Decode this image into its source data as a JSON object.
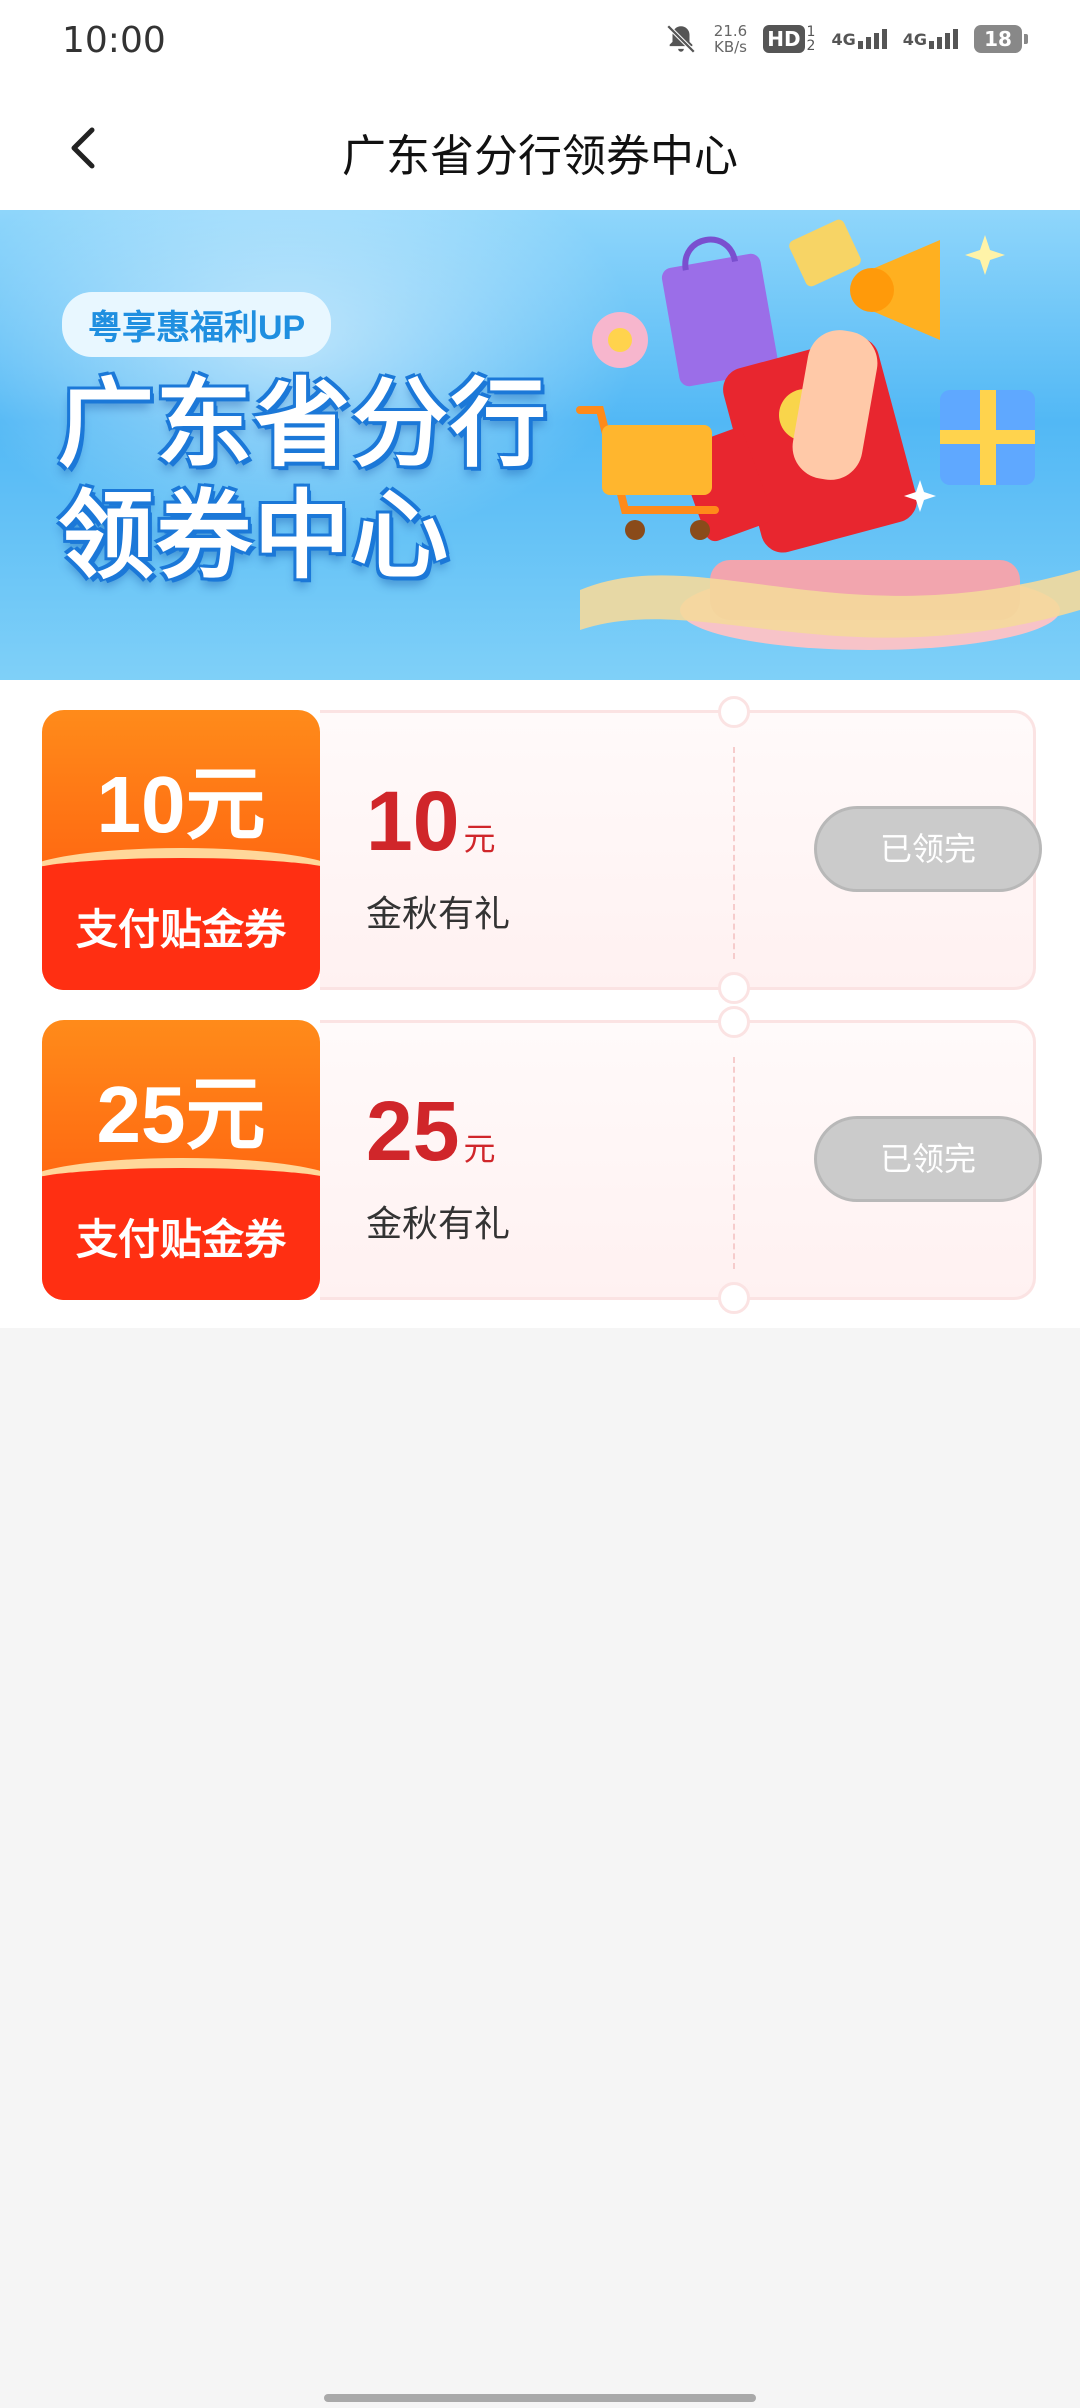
{
  "status_bar": {
    "time": "10:00",
    "net_speed_value": "21.6",
    "net_speed_unit": "KB/s",
    "hd_label": "HD",
    "hd_sub_top": "1",
    "hd_sub_bottom": "2",
    "signal_1": "4G",
    "signal_2": "4G",
    "battery": "18"
  },
  "nav": {
    "title": "广东省分行领券中心"
  },
  "banner": {
    "tag": "粤享惠福利UP",
    "title_line1": "广东省分行",
    "title_line2": "领券中心"
  },
  "coupons": [
    {
      "badge_amount": "10元",
      "badge_type": "支付贴金券",
      "amount": "10",
      "unit": "元",
      "desc": "金秋有礼",
      "button": "已领完"
    },
    {
      "badge_amount": "25元",
      "badge_type": "支付贴金券",
      "amount": "25",
      "unit": "元",
      "desc": "金秋有礼",
      "button": "已领完"
    }
  ],
  "colors": {
    "accent_red": "#d0262a",
    "badge_orange": "#ff6a12",
    "banner_blue": "#52b8f5",
    "button_disabled": "#cbcbcb"
  }
}
